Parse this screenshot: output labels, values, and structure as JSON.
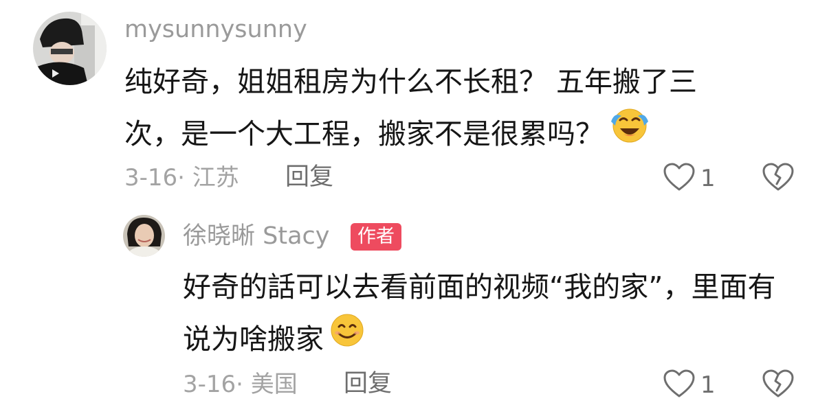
{
  "comments": [
    {
      "username": "mysunnysunny",
      "text": "纯好奇，姐姐租房为什么不长租？ 五年搬了三次，是一个大工程，搬家不是很累吗？",
      "emoji": "laughing-crying-face",
      "date_location": "3-16· 江苏",
      "reply_label": "回复",
      "like_count": "1"
    },
    {
      "username": "徐晓晰 Stacy",
      "badge": "作者",
      "text": "好奇的話可以去看前面的视频“我的家”，里面有说为啥搬家",
      "emoji": "smiling-face",
      "date_location": "3-16· 美国",
      "reply_label": "回复",
      "like_count": "1"
    }
  ],
  "colors": {
    "badge": "#ee4b5f",
    "muted_text": "#9a9a9a",
    "body_text": "#161616"
  }
}
